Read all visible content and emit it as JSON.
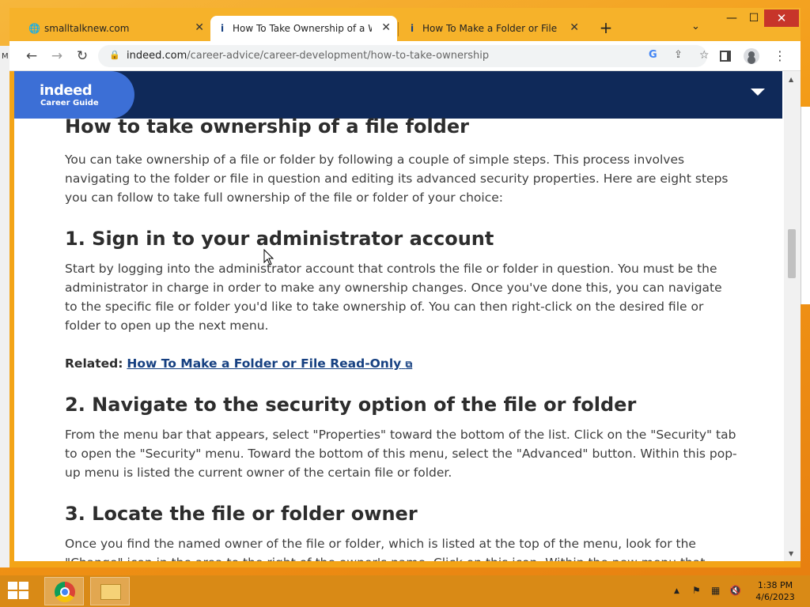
{
  "browser": {
    "tabs": [
      {
        "favicon": "globe-icon",
        "title": "smalltalknew.com",
        "active": false
      },
      {
        "favicon": "indeed-icon",
        "title": "How To Take Ownership of a Win",
        "active": true
      },
      {
        "favicon": "indeed-icon",
        "title": "How To Make a Folder or File Rea",
        "active": false
      }
    ],
    "url_host": "indeed.com",
    "url_path": "/career-advice/career-development/how-to-take-ownership"
  },
  "site": {
    "logo_word": "indeed",
    "logo_sub": "Career Guide"
  },
  "article": {
    "heading_main": "How to take ownership of a file folder",
    "intro": "You can take ownership of a file or folder by following a couple of simple steps. This process involves navigating to the folder or file in question and editing its advanced security properties. Here are eight steps you can follow to take full ownership of the file or folder of your choice:",
    "step1_heading": "1. Sign in to your administrator account",
    "step1_text": "Start by logging into the administrator account that controls the file or folder in question. You must be the administrator in charge in order to make any ownership changes. Once you've done this, you can navigate to the specific file or folder you'd like to take ownership of. You can then right-click on the desired file or folder to open up the next menu.",
    "related_label": "Related:",
    "related_link": "How To Make a Folder or File Read-Only",
    "step2_heading": "2. Navigate to the security option of the file or folder",
    "step2_text": "From the menu bar that appears, select \"Properties\" toward the bottom of the list. Click on the \"Security\" tab to open the \"Security\" menu. Toward the bottom of this menu, select the \"Advanced\" button. Within this pop-up menu is listed the current owner of the certain file or folder.",
    "step3_heading": "3. Locate the file or folder owner",
    "step3_text": "Once you find the named owner of the file or folder, which is listed at the top of the menu, look for the \"Change\" icon in the area to the right of the owner's name. Click on this icon. Within the new menu that appears, click the"
  },
  "taskbar": {
    "time": "1:38 PM",
    "date": "4/6/2023"
  },
  "left_edge_text": "M",
  "colors": {
    "header_navy": "#0f2959",
    "logo_blue": "#3c6fd6",
    "link_blue": "#164081",
    "tabstrip": "#f6b22a"
  }
}
